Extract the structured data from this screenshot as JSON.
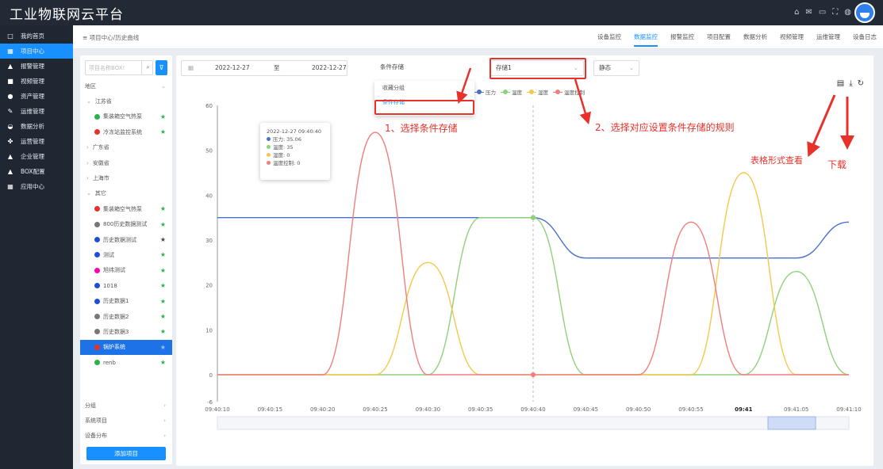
{
  "app": {
    "title": "工业物联网云平台"
  },
  "nav": {
    "items": [
      {
        "label": "我的首页",
        "icon": "□"
      },
      {
        "label": "项目中心",
        "icon": "▦"
      },
      {
        "label": "报警管理",
        "icon": "▲"
      },
      {
        "label": "视频管理",
        "icon": "■"
      },
      {
        "label": "资产管理",
        "icon": "●"
      },
      {
        "label": "运维管理",
        "icon": "✎"
      },
      {
        "label": "数据分析",
        "icon": "◒"
      },
      {
        "label": "运营管理",
        "icon": "✤"
      },
      {
        "label": "企业管理",
        "icon": "▲"
      },
      {
        "label": "BOX配置",
        "icon": "▲"
      },
      {
        "label": "应用中心",
        "icon": "▦"
      }
    ]
  },
  "breadcrumb": "≡ 项目中心/历史曲线",
  "tabs": [
    "设备监控",
    "数据监控",
    "报警监控",
    "项目配置",
    "数据分析",
    "视频管理",
    "运维管理",
    "设备日志"
  ],
  "tree": {
    "search_placeholder": "项目名称BOX!",
    "filter_icon": "filter-icon",
    "rows": [
      {
        "label": "地区",
        "type": "section"
      },
      {
        "label": "江苏省",
        "type": "group"
      },
      {
        "label": "集装箱空气热泵",
        "type": "item",
        "color": "#2bb24c",
        "star": "green"
      },
      {
        "label": "冷冻站监控系统",
        "type": "item",
        "color": "#e8312a",
        "star": "green"
      },
      {
        "label": "广东省",
        "type": "groupc"
      },
      {
        "label": "安徽省",
        "type": "groupc"
      },
      {
        "label": "上海市",
        "type": "groupc"
      },
      {
        "label": "其它",
        "type": "group"
      },
      {
        "label": "集装箱空气热泵",
        "type": "item",
        "color": "#e8312a",
        "star": "green"
      },
      {
        "label": "800历史数据测试",
        "type": "item",
        "color": "#777",
        "star": "green"
      },
      {
        "label": "历史数据测试",
        "type": "item",
        "color": "#1d4ed8",
        "star": "gray"
      },
      {
        "label": "测试",
        "type": "item",
        "color": "#1d4ed8",
        "star": "green"
      },
      {
        "label": "旭纬测试",
        "type": "item",
        "color": "#f0a",
        "star": "green"
      },
      {
        "label": "1018",
        "type": "item",
        "color": "#1d4ed8",
        "star": "green"
      },
      {
        "label": "历史数据1",
        "type": "item",
        "color": "#1d4ed8",
        "star": "green"
      },
      {
        "label": "历史数据2",
        "type": "item",
        "color": "#777",
        "star": "green"
      },
      {
        "label": "历史数据3",
        "type": "item",
        "color": "#777",
        "star": "green"
      },
      {
        "label": "锅炉系统",
        "type": "item",
        "color": "#e8312a",
        "star": "white",
        "selected": true
      },
      {
        "label": "renb",
        "type": "item",
        "color": "#2bb24c",
        "star": "green"
      }
    ],
    "bottom": [
      "分组",
      "系统项目",
      "设备分布"
    ],
    "add_button": "添加项目"
  },
  "filters": {
    "start_date": "2022-12-27",
    "to": "至",
    "end_date": "2022-12-27",
    "condition": "条件存储",
    "storage": "存储1",
    "mode": "静态"
  },
  "dropdown": {
    "items": [
      "收藏分组",
      "条件存储"
    ]
  },
  "legend": [
    {
      "label": "压力",
      "color": "#4a70c9"
    },
    {
      "label": "温度",
      "color": "#8ed27a"
    },
    {
      "label": "湿度",
      "color": "#f5c84b"
    },
    {
      "label": "温度控制",
      "color": "#f07e7e"
    }
  ],
  "tooltip": {
    "time": "2022-12-27 09:40:40",
    "lines": [
      {
        "label": "压力: 35.06",
        "color": "#4a70c9"
      },
      {
        "label": "温度: 35",
        "color": "#8ed27a"
      },
      {
        "label": "湿度: 0",
        "color": "#f5c84b"
      },
      {
        "label": "温度控制: 0",
        "color": "#f07e7e"
      }
    ]
  },
  "annotations": {
    "step1": "1、选择条件存储",
    "step2": "2、选择对应设置条件存储的规则",
    "table_view": "表格形式查看",
    "download": "下载"
  },
  "chart_data": {
    "type": "line",
    "x": [
      "09:40:10",
      "09:40:15",
      "09:40:20",
      "09:40:25",
      "09:40:30",
      "09:40:35",
      "09:40:40",
      "09:40:45",
      "09:40:50",
      "09:40:55",
      "09:41",
      "09:41:05",
      "09:41:10"
    ],
    "yticks": [
      -6,
      0,
      10,
      20,
      30,
      40,
      50,
      60
    ],
    "ylim": [
      -6,
      60
    ],
    "series": [
      {
        "name": "压力",
        "color": "#4a70c9",
        "values": [
          35,
          35,
          35,
          35,
          35,
          35,
          35,
          26,
          26,
          26,
          26,
          26,
          34
        ]
      },
      {
        "name": "温度",
        "color": "#8ed27a",
        "values": [
          0,
          0,
          0,
          0,
          0,
          35,
          35,
          0,
          0,
          0,
          0,
          23,
          0
        ]
      },
      {
        "name": "湿度",
        "color": "#f5c84b",
        "values": [
          0,
          0,
          0,
          0,
          25,
          0,
          0,
          0,
          0,
          0,
          45,
          0,
          0
        ]
      },
      {
        "name": "温度控制",
        "color": "#f07e7e",
        "values": [
          0,
          0,
          0,
          54,
          0,
          0,
          0,
          0,
          0,
          34,
          0,
          0,
          0
        ]
      }
    ]
  }
}
